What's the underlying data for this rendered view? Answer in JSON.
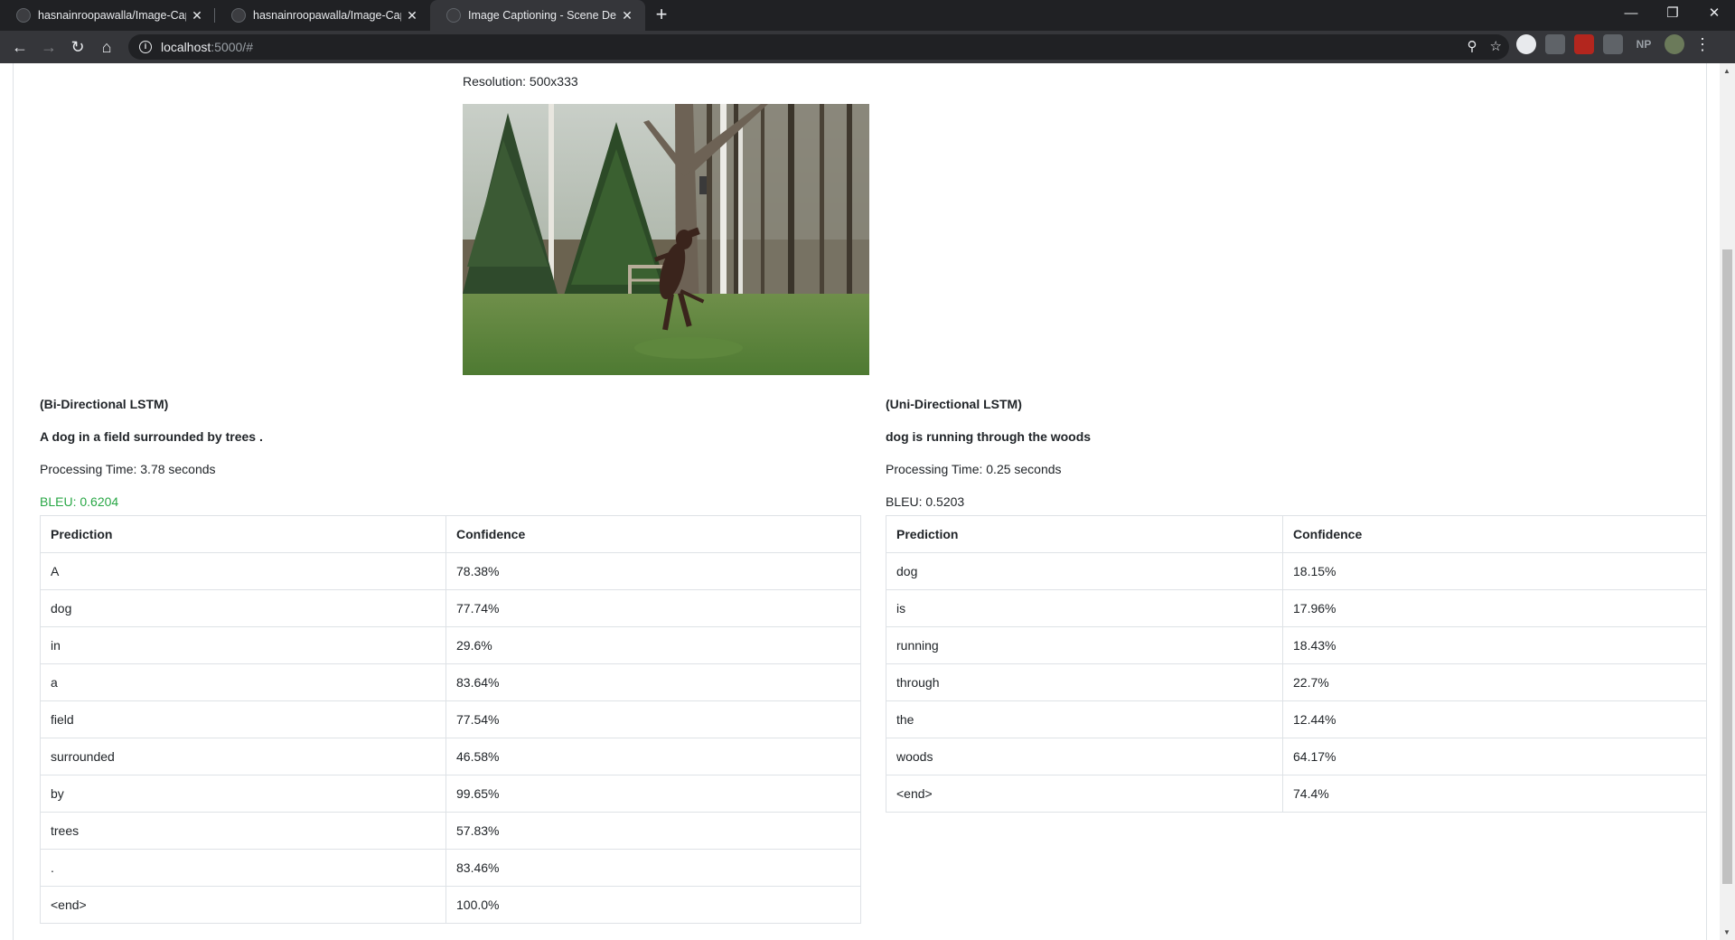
{
  "browser": {
    "tabs": [
      {
        "title": "hasnainroopawalla/Image-Captic",
        "active": false
      },
      {
        "title": "hasnainroopawalla/Image-Captic",
        "active": false
      },
      {
        "title": "Image Captioning - Scene Descri",
        "active": true
      }
    ],
    "url_host": "localhost",
    "url_path": ":5000/#",
    "extensions": [
      "",
      "",
      "",
      "",
      "NP",
      ""
    ]
  },
  "page": {
    "resolution": "Resolution: 500x333",
    "models": [
      {
        "name": "(Bi-Directional LSTM)",
        "caption": "A dog in a field surrounded by trees .",
        "processing_time": "Processing Time: 3.78 seconds",
        "bleu": "BLEU: 0.6204",
        "bleu_color": "#28a745",
        "headers": [
          "Prediction",
          "Confidence"
        ],
        "rows": [
          [
            "A",
            "78.38%"
          ],
          [
            "dog",
            "77.74%"
          ],
          [
            "in",
            "29.6%"
          ],
          [
            "a",
            "83.64%"
          ],
          [
            "field",
            "77.54%"
          ],
          [
            "surrounded",
            "46.58%"
          ],
          [
            "by",
            "99.65%"
          ],
          [
            "trees",
            "57.83%"
          ],
          [
            ".",
            "83.46%"
          ],
          [
            "<end>",
            "100.0%"
          ]
        ]
      },
      {
        "name": "(Uni-Directional LSTM)",
        "caption": "dog is running through the woods",
        "processing_time": "Processing Time: 0.25 seconds",
        "bleu": "BLEU: 0.5203",
        "bleu_color": "#212529",
        "headers": [
          "Prediction",
          "Confidence"
        ],
        "rows": [
          [
            "dog",
            "18.15%"
          ],
          [
            "is",
            "17.96%"
          ],
          [
            "running",
            "18.43%"
          ],
          [
            "through",
            "22.7%"
          ],
          [
            "the",
            "12.44%"
          ],
          [
            "woods",
            "64.17%"
          ],
          [
            "<end>",
            "74.4%"
          ]
        ]
      }
    ]
  }
}
